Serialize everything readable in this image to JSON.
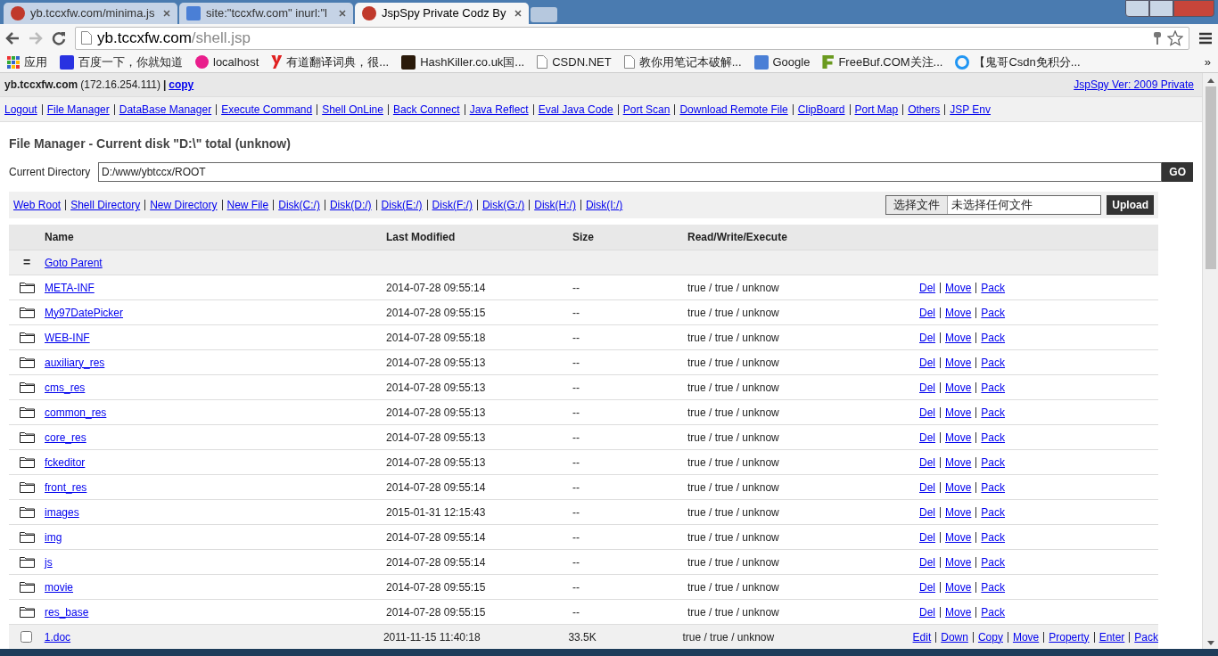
{
  "browser": {
    "tabs": [
      {
        "title": "yb.tccxfw.com/minima.js",
        "selected": false
      },
      {
        "title": "site:\"tccxfw.com\" inurl:\"l",
        "selected": false
      },
      {
        "title": "JspSpy Private Codz By",
        "selected": true
      }
    ],
    "url_host": "yb.tccxfw.com",
    "url_path": "/shell.jsp",
    "bookmarks": [
      "应用",
      "百度一下，你就知道",
      "localhost",
      "有道翻译词典，很...",
      "HashKiller.co.uk国...",
      "CSDN.NET",
      "教你用笔记本破解...",
      "Google",
      "FreeBuf.COM关注...",
      "【鬼哥Csdn免积分..."
    ],
    "more": "»"
  },
  "header": {
    "host": "yb.tccxfw.com",
    "ip": "(172.16.254.111)",
    "sep": "|",
    "copy": "copy",
    "version": "JspSpy Ver: 2009 Private"
  },
  "nav": [
    "Logout",
    "File Manager",
    "DataBase Manager",
    "Execute Command",
    "Shell OnLine",
    "Back Connect",
    "Java Reflect",
    "Eval Java Code",
    "Port Scan",
    "Download Remote File",
    "ClipBoard",
    "Port Map",
    "Others",
    "JSP Env"
  ],
  "title": "File Manager - Current disk \"D:\\\" total (unknow)",
  "directory": {
    "label": "Current Directory",
    "value": "D:/www/ybtccx/ROOT",
    "button": "GO"
  },
  "tools": [
    "Web Root",
    "Shell Directory",
    "New Directory",
    "New File",
    "Disk(C:/)",
    "Disk(D:/)",
    "Disk(E:/)",
    "Disk(F:/)",
    "Disk(G:/)",
    "Disk(H:/)",
    "Disk(I:/)"
  ],
  "upload": {
    "choose": "选择文件",
    "status": "未选择任何文件",
    "button": "Upload"
  },
  "table": {
    "columns": [
      "Name",
      "Last Modified",
      "Size",
      "Read/Write/Execute"
    ],
    "rows": [
      {
        "kind": "parent",
        "icon": "=",
        "name": "Goto Parent"
      },
      {
        "kind": "folder",
        "name": "META-INF",
        "modified": "2014-07-28 09:55:14",
        "size": "--",
        "rwx": "true / true / unknow",
        "actions": [
          "Del",
          "Move",
          "Pack"
        ]
      },
      {
        "kind": "folder",
        "name": "My97DatePicker",
        "modified": "2014-07-28 09:55:15",
        "size": "--",
        "rwx": "true / true / unknow",
        "actions": [
          "Del",
          "Move",
          "Pack"
        ]
      },
      {
        "kind": "folder",
        "name": "WEB-INF",
        "modified": "2014-07-28 09:55:18",
        "size": "--",
        "rwx": "true / true / unknow",
        "actions": [
          "Del",
          "Move",
          "Pack"
        ]
      },
      {
        "kind": "folder",
        "name": "auxiliary_res",
        "modified": "2014-07-28 09:55:13",
        "size": "--",
        "rwx": "true / true / unknow",
        "actions": [
          "Del",
          "Move",
          "Pack"
        ]
      },
      {
        "kind": "folder",
        "name": "cms_res",
        "modified": "2014-07-28 09:55:13",
        "size": "--",
        "rwx": "true / true / unknow",
        "actions": [
          "Del",
          "Move",
          "Pack"
        ]
      },
      {
        "kind": "folder",
        "name": "common_res",
        "modified": "2014-07-28 09:55:13",
        "size": "--",
        "rwx": "true / true / unknow",
        "actions": [
          "Del",
          "Move",
          "Pack"
        ]
      },
      {
        "kind": "folder",
        "name": "core_res",
        "modified": "2014-07-28 09:55:13",
        "size": "--",
        "rwx": "true / true / unknow",
        "actions": [
          "Del",
          "Move",
          "Pack"
        ]
      },
      {
        "kind": "folder",
        "name": "fckeditor",
        "modified": "2014-07-28 09:55:13",
        "size": "--",
        "rwx": "true / true / unknow",
        "actions": [
          "Del",
          "Move",
          "Pack"
        ]
      },
      {
        "kind": "folder",
        "name": "front_res",
        "modified": "2014-07-28 09:55:14",
        "size": "--",
        "rwx": "true / true / unknow",
        "actions": [
          "Del",
          "Move",
          "Pack"
        ]
      },
      {
        "kind": "folder",
        "name": "images",
        "modified": "2015-01-31 12:15:43",
        "size": "--",
        "rwx": "true / true / unknow",
        "actions": [
          "Del",
          "Move",
          "Pack"
        ]
      },
      {
        "kind": "folder",
        "name": "img",
        "modified": "2014-07-28 09:55:14",
        "size": "--",
        "rwx": "true / true / unknow",
        "actions": [
          "Del",
          "Move",
          "Pack"
        ]
      },
      {
        "kind": "folder",
        "name": "js",
        "modified": "2014-07-28 09:55:14",
        "size": "--",
        "rwx": "true / true / unknow",
        "actions": [
          "Del",
          "Move",
          "Pack"
        ]
      },
      {
        "kind": "folder",
        "name": "movie",
        "modified": "2014-07-28 09:55:15",
        "size": "--",
        "rwx": "true / true / unknow",
        "actions": [
          "Del",
          "Move",
          "Pack"
        ]
      },
      {
        "kind": "folder",
        "name": "res_base",
        "modified": "2014-07-28 09:55:15",
        "size": "--",
        "rwx": "true / true / unknow",
        "actions": [
          "Del",
          "Move",
          "Pack"
        ]
      },
      {
        "kind": "file",
        "checked": false,
        "name": "1.doc",
        "modified": "2011-11-15 11:40:18",
        "size": "33.5K",
        "rwx": "true / true / unknow",
        "actions": [
          "Edit",
          "Down",
          "Copy",
          "Move",
          "Property",
          "Enter",
          "Pack"
        ]
      }
    ]
  }
}
